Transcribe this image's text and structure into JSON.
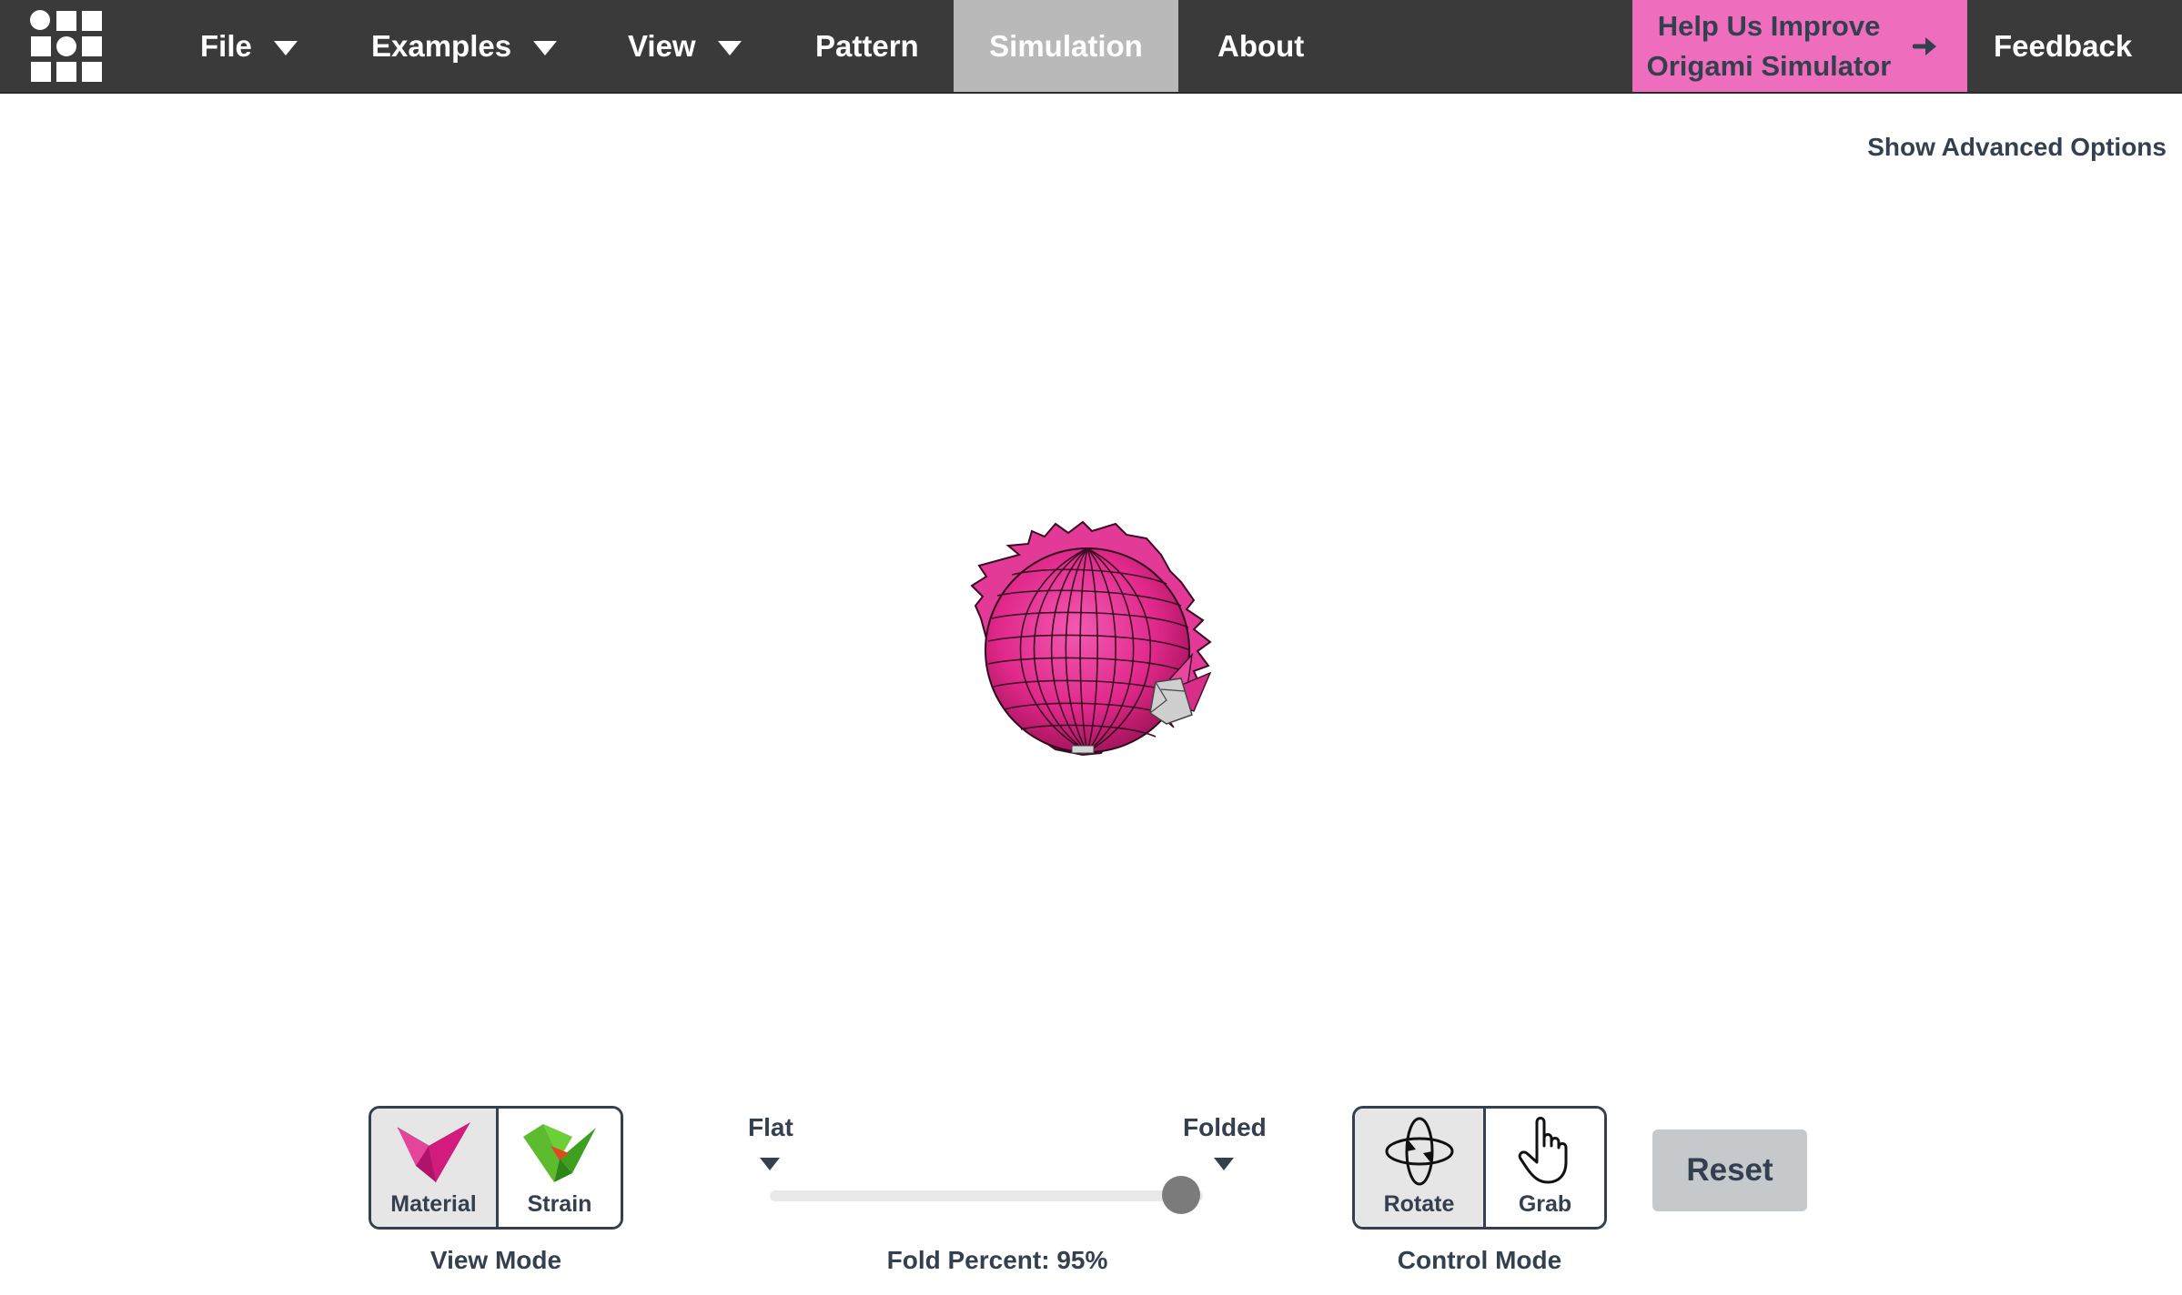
{
  "nav": {
    "items": [
      {
        "label": "File",
        "has_caret": true
      },
      {
        "label": "Examples",
        "has_caret": true
      },
      {
        "label": "View",
        "has_caret": true
      },
      {
        "label": "Pattern",
        "has_caret": false
      },
      {
        "label": "Simulation",
        "active": true
      },
      {
        "label": "About",
        "has_caret": false
      }
    ],
    "help_button": {
      "line1": "Help Us Improve",
      "line2": "Origami Simulator",
      "icon": "arrow-right-icon"
    },
    "feedback": "Feedback",
    "logo_icon": "grid-logo-icon"
  },
  "advanced_options_link": "Show Advanced Options",
  "model": {
    "description_icon": "origami-model-icon",
    "color": "#e0288a"
  },
  "view_mode": {
    "caption": "View Mode",
    "buttons": [
      {
        "label": "Material",
        "icon": "material-icon",
        "selected": true
      },
      {
        "label": "Strain",
        "icon": "strain-icon",
        "selected": false
      }
    ]
  },
  "fold_slider": {
    "flat_label": "Flat",
    "folded_label": "Folded",
    "percent_text": "Fold Percent: 95%",
    "value_percent": 95
  },
  "control_mode": {
    "caption": "Control Mode",
    "buttons": [
      {
        "label": "Rotate",
        "icon": "rotate-icon",
        "selected": true
      },
      {
        "label": "Grab",
        "icon": "hand-pointer-icon",
        "selected": false
      }
    ]
  },
  "reset_label": "Reset",
  "colors": {
    "nav_bg": "#3a3a3a",
    "nav_active": "#b9b9b9",
    "help_bg": "#ee6dbd",
    "text_dark": "#34404f",
    "model_pink": "#e0288a"
  }
}
